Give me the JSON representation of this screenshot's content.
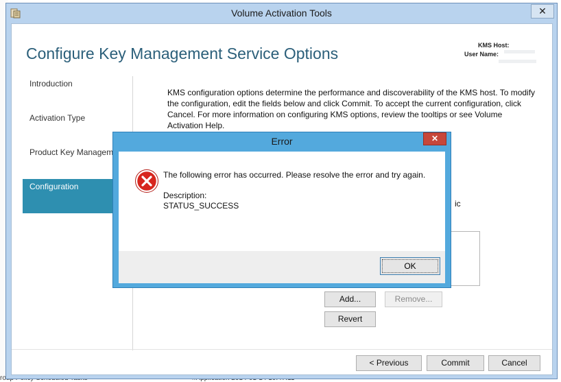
{
  "window": {
    "title": "Volume Activation Tools",
    "close_glyph": "✕"
  },
  "page": {
    "heading": "Configure Key Management Service Options",
    "kms_host_label": "KMS Host:",
    "user_name_label": "User Name:"
  },
  "nav": {
    "items": [
      {
        "label": "Introduction",
        "active": false
      },
      {
        "label": "Activation Type",
        "active": false
      },
      {
        "label": "Product Key Management",
        "active": false
      },
      {
        "label": "Configuration",
        "active": true
      }
    ]
  },
  "content": {
    "description": "KMS configuration options determine the performance and discoverability of the KMS host. To modify the configuration, edit the fields below and click Commit. To accept the current configuration, click Cancel. For more information on configuring KMS options, review the tooltips or see Volume Activation Help.",
    "partial_text": "ic"
  },
  "buttons": {
    "add": "Add...",
    "remove": "Remove...",
    "revert": "Revert",
    "previous": "< Previous",
    "commit": "Commit",
    "cancel": "Cancel"
  },
  "error_dialog": {
    "title": "Error",
    "close_glyph": "✕",
    "message": "The following error has occurred. Please resolve the error and try again.",
    "description_label": "Description:",
    "description_value": "STATUS_SUCCESS",
    "ok_label": "OK",
    "icon": "error-x-icon"
  },
  "background_window": {
    "bottom_text_1": "roup Policy Scheduled Tasks",
    "bottom_text_2": "#Application   2014-01-14 10:47:11"
  },
  "colors": {
    "accent": "#2e8fb0",
    "heading": "#2b5f7a",
    "dialog_frame": "#53a9dd",
    "close_red": "#c7473a",
    "error_icon": "#d7261e"
  }
}
